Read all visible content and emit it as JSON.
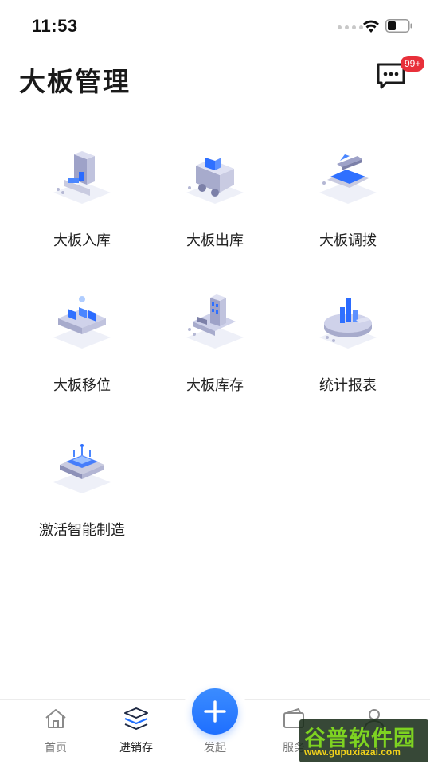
{
  "status_bar": {
    "time": "11:53"
  },
  "header": {
    "title": "大板管理",
    "message_badge": "99+"
  },
  "grid": {
    "items": [
      {
        "label": "大板入库",
        "icon": "inbound-icon"
      },
      {
        "label": "大板出库",
        "icon": "outbound-truck-icon"
      },
      {
        "label": "大板调拨",
        "icon": "transfer-icon"
      },
      {
        "label": "大板移位",
        "icon": "relocate-icon"
      },
      {
        "label": "大板库存",
        "icon": "inventory-building-icon"
      },
      {
        "label": "统计报表",
        "icon": "statistics-chart-icon"
      },
      {
        "label": "激活智能制造",
        "icon": "smart-chip-icon"
      }
    ]
  },
  "tabbar": {
    "tabs": [
      {
        "label": "首页",
        "icon": "home-icon"
      },
      {
        "label": "进销存",
        "icon": "layers-icon",
        "active": true
      },
      {
        "label": "发起",
        "icon": "plus-icon"
      },
      {
        "label": "服务",
        "icon": "wallet-icon"
      },
      {
        "label": "",
        "icon": "person-icon"
      }
    ]
  },
  "watermark": {
    "text": "谷普软件园",
    "url": "www.gupuxiazai.com"
  },
  "colors": {
    "accent": "#1f6fff",
    "badge": "#e8303a"
  }
}
